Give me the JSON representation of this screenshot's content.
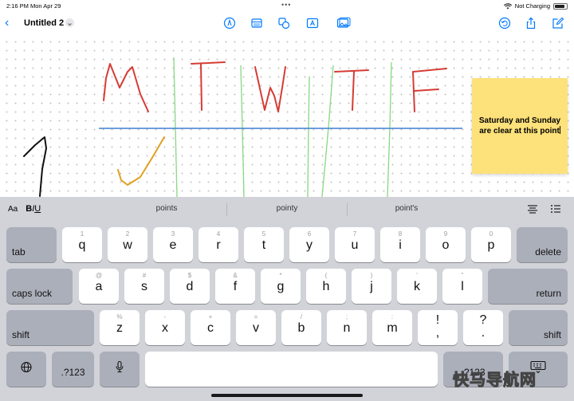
{
  "status_bar": {
    "time": "2:16 PM  Mon Apr 29",
    "charging": "Not Charging",
    "battery_level": 0.85
  },
  "toolbar": {
    "document_title": "Untitled 2"
  },
  "canvas": {
    "sticky_note": "Saturday and Sunday are clear at this point"
  },
  "predictive": {
    "format_label": "Aa",
    "bold": "B",
    "italic": "I",
    "underline": "U",
    "suggestions": [
      "points",
      "pointy",
      "point's"
    ]
  },
  "keyboard": {
    "row1": [
      {
        "alt": "1",
        "main": "q"
      },
      {
        "alt": "2",
        "main": "w"
      },
      {
        "alt": "3",
        "main": "e"
      },
      {
        "alt": "4",
        "main": "r"
      },
      {
        "alt": "5",
        "main": "t"
      },
      {
        "alt": "6",
        "main": "y"
      },
      {
        "alt": "7",
        "main": "u"
      },
      {
        "alt": "8",
        "main": "i"
      },
      {
        "alt": "9",
        "main": "o"
      },
      {
        "alt": "0",
        "main": "p"
      }
    ],
    "row2": [
      {
        "alt": "@",
        "main": "a"
      },
      {
        "alt": "#",
        "main": "s"
      },
      {
        "alt": "$",
        "main": "d"
      },
      {
        "alt": "&",
        "main": "f"
      },
      {
        "alt": "*",
        "main": "g"
      },
      {
        "alt": "(",
        "main": "h"
      },
      {
        "alt": ")",
        "main": "j"
      },
      {
        "alt": "'",
        "main": "k"
      },
      {
        "alt": "\"",
        "main": "l"
      }
    ],
    "row3": [
      {
        "alt": "%",
        "main": "z"
      },
      {
        "alt": "-",
        "main": "x"
      },
      {
        "alt": "+",
        "main": "c"
      },
      {
        "alt": "=",
        "main": "v"
      },
      {
        "alt": "/",
        "main": "b"
      },
      {
        "alt": ";",
        "main": "n"
      },
      {
        "alt": ":",
        "main": "m"
      }
    ],
    "tab": "tab",
    "delete": "delete",
    "caps_lock": "caps lock",
    "return": "return",
    "shift": "shift",
    "punct_comma_top": "!",
    "punct_comma_bottom": ",",
    "punct_period_top": "?",
    "punct_period_bottom": ".",
    "numbers_left": ".?123",
    "numbers_right": ".?123"
  },
  "watermark": "快马导航网",
  "colors": {
    "accent": "#007aff",
    "keyboard_bg": "#d1d3d9",
    "dark_key": "#abafba",
    "sticky": "#fde17a",
    "ink_red": "#d63c35",
    "ink_green": "#8fd98a",
    "ink_blue": "#3d7ed6",
    "ink_orange": "#e0a020"
  }
}
